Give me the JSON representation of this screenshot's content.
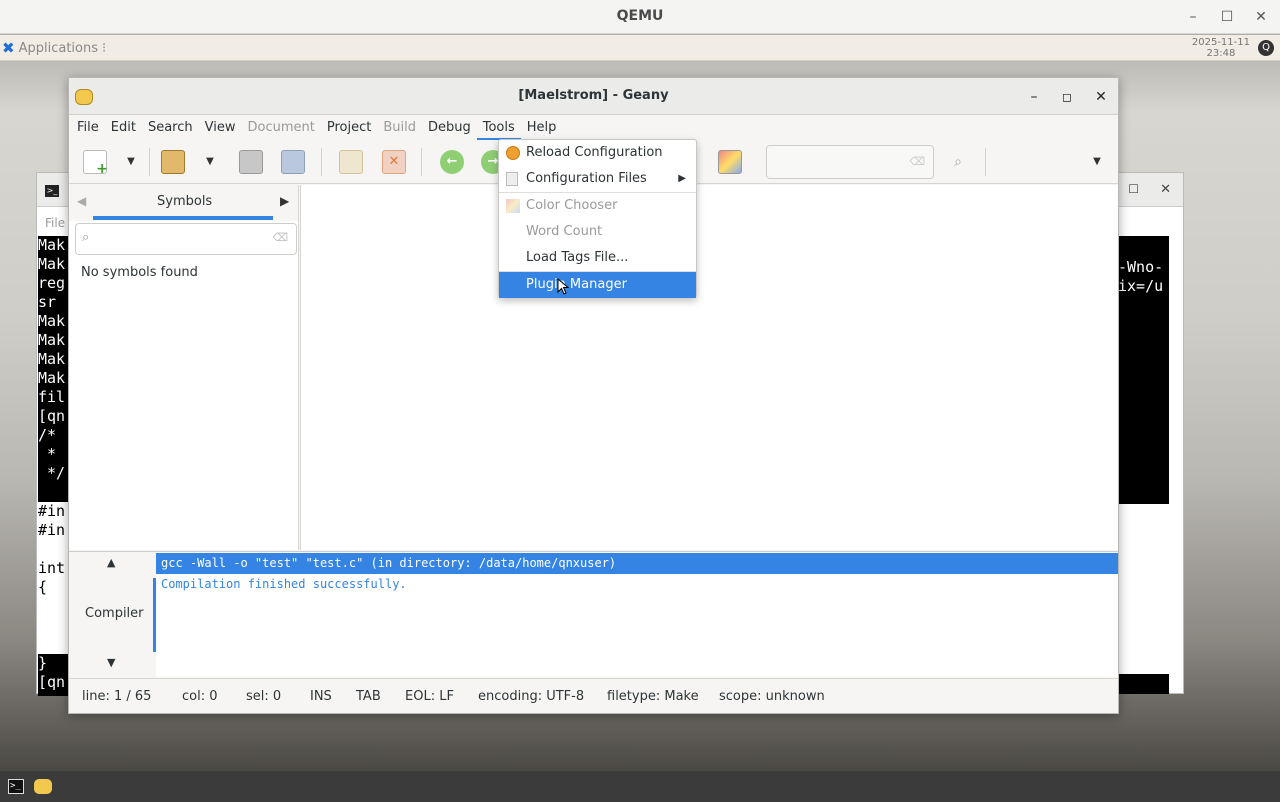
{
  "qemu": {
    "title": "QEMU"
  },
  "panel": {
    "applications_label": "Applications",
    "clock_date": "2025-11-11",
    "clock_time": "23:48"
  },
  "bg_terminal": {
    "menu_text": "File",
    "left_lines": [
      "Mak",
      "Mak",
      "reg",
      "sr",
      "Mak",
      "Mak",
      "Mak",
      "Mak",
      "fil",
      "[qn",
      "/*",
      " *",
      " */",
      "",
      "#in",
      "#in",
      "",
      "int",
      "{",
      "",
      "",
      "",
      "}",
      "[qn"
    ],
    "right_lines": [
      "-Wno-",
      "ix=/u"
    ]
  },
  "geany": {
    "title": "[Maelstrom] - Geany",
    "menu": [
      "File",
      "Edit",
      "Search",
      "View",
      "Document",
      "Project",
      "Build",
      "Debug",
      "Tools",
      "Help"
    ],
    "sidebar": {
      "tab": "Symbols",
      "empty": "No symbols found"
    },
    "bottom": {
      "tab": "Compiler",
      "messages": [
        "gcc -Wall -o \"test\" \"test.c\" (in directory: /data/home/qnxuser)",
        "Compilation finished successfully."
      ]
    },
    "status": {
      "line": "line: 1 / 65",
      "col": "col: 0",
      "sel": "sel: 0",
      "ins": "INS",
      "tab": "TAB",
      "eol": "EOL: LF",
      "encoding": "encoding: UTF-8",
      "filetype": "filetype: Make",
      "scope": "scope: unknown"
    }
  },
  "tools_menu": {
    "items": [
      "Reload Configuration",
      "Configuration Files",
      "Color Chooser",
      "Word Count",
      "Load Tags File...",
      "Plugin Manager"
    ]
  },
  "colors": {
    "accent": "#3584e4",
    "disabled": "#9a9a9a"
  }
}
